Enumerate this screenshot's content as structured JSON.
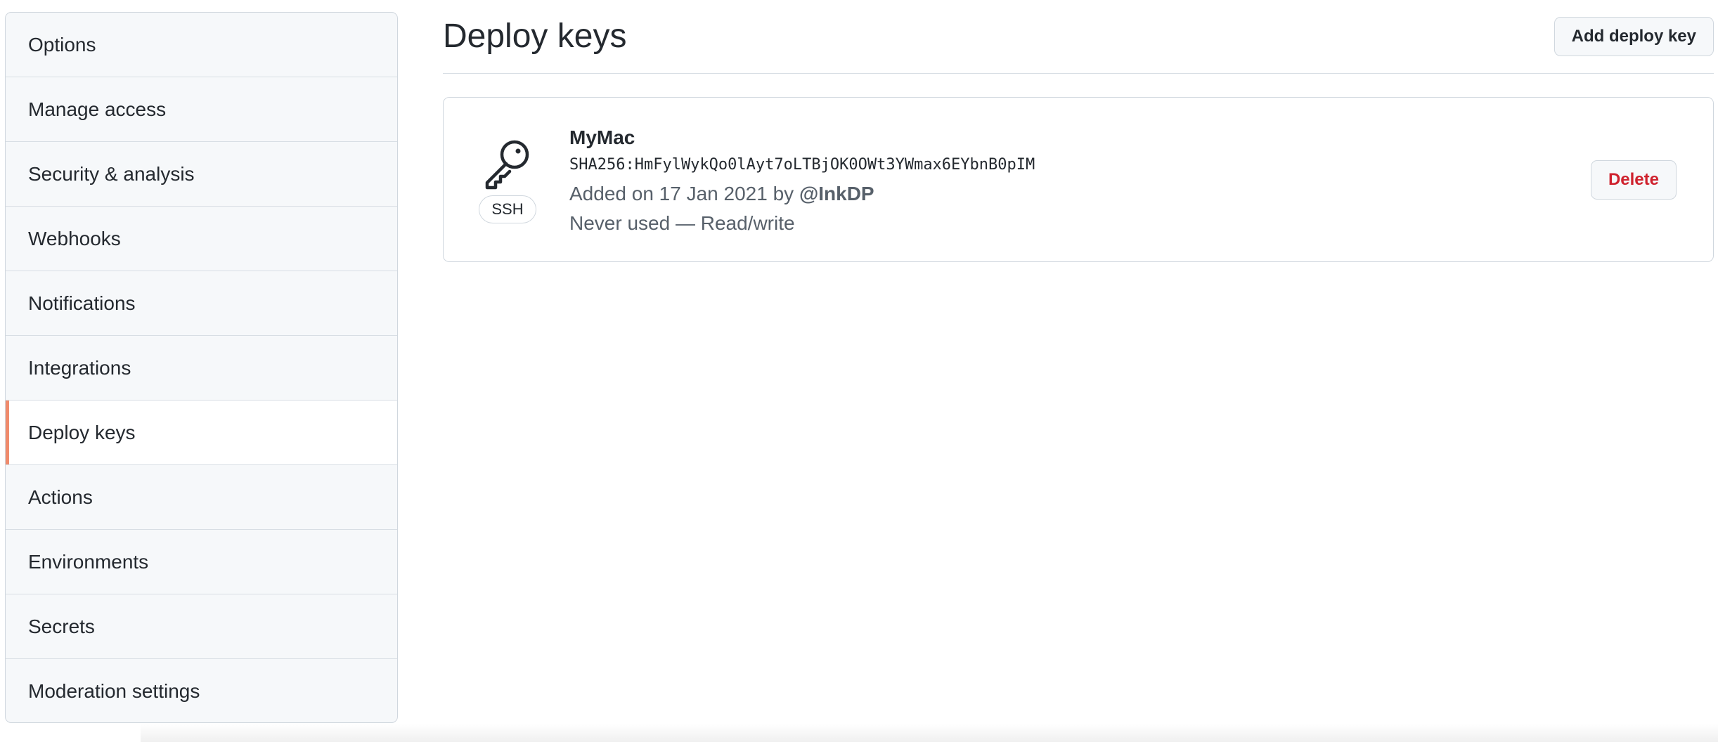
{
  "sidebar": {
    "items": [
      {
        "label": "Options"
      },
      {
        "label": "Manage access"
      },
      {
        "label": "Security & analysis"
      },
      {
        "label": "Webhooks"
      },
      {
        "label": "Notifications"
      },
      {
        "label": "Integrations"
      },
      {
        "label": "Deploy keys",
        "selected": true
      },
      {
        "label": "Actions"
      },
      {
        "label": "Environments"
      },
      {
        "label": "Secrets"
      },
      {
        "label": "Moderation settings"
      }
    ],
    "selected_accent": "#f08b6c"
  },
  "header": {
    "title": "Deploy keys",
    "add_button_label": "Add deploy key"
  },
  "keys": [
    {
      "icon": "key-icon",
      "type_badge": "SSH",
      "title": "MyMac",
      "fingerprint": "SHA256:HmFylWykQo0lAyt7oLTBjOK0OWt3YWmax6EYbnB0pIM",
      "added_prefix": "Added on 17 Jan 2021 by",
      "added_by": "@InkDP",
      "usage": "Never used — Read/write",
      "delete_label": "Delete"
    }
  ],
  "colors": {
    "danger": "#cf222e",
    "border": "#d0d7de",
    "muted_text": "#57606a"
  }
}
